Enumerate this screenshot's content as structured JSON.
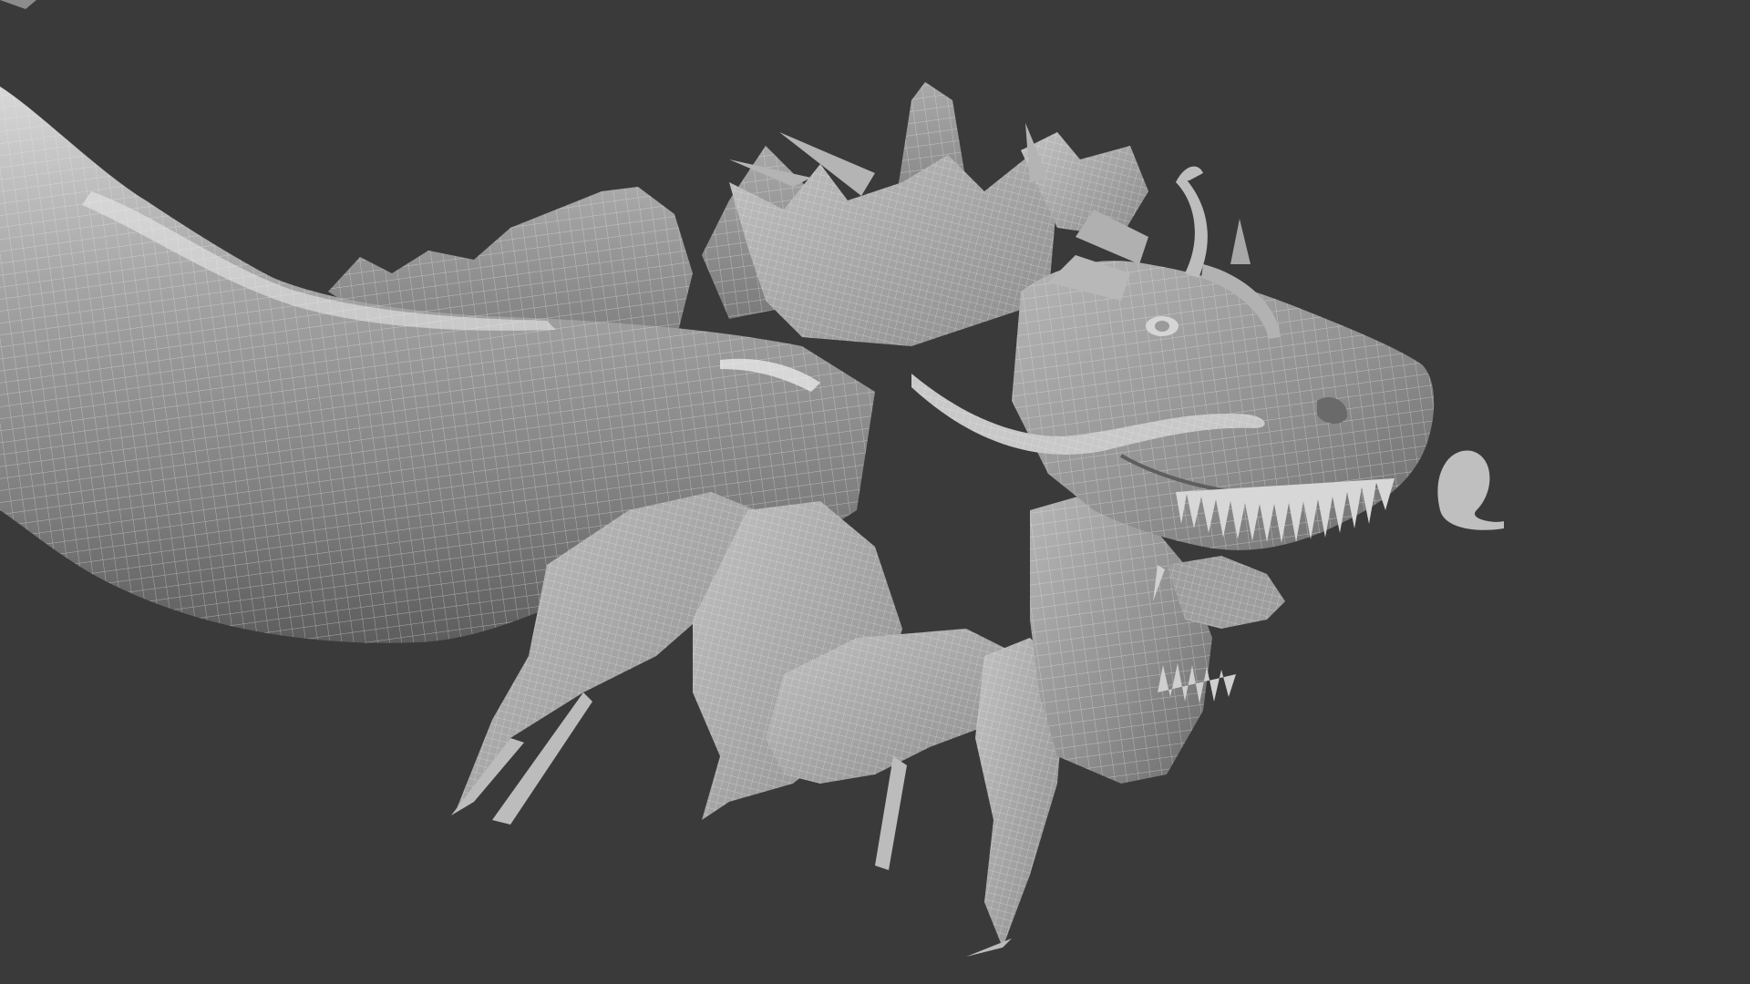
{
  "viewport": {
    "background_color": "#3a3a3a",
    "display_mode": "shaded-wireframe",
    "model": {
      "subject": "dragon",
      "visible_parts": [
        "neck",
        "head",
        "horns",
        "whiskers",
        "mane-frills",
        "open-jaw",
        "teeth",
        "tongue",
        "dorsal-fins"
      ],
      "surface_color": "#9a9a9a",
      "wire_color": "#e8e8e8"
    }
  }
}
